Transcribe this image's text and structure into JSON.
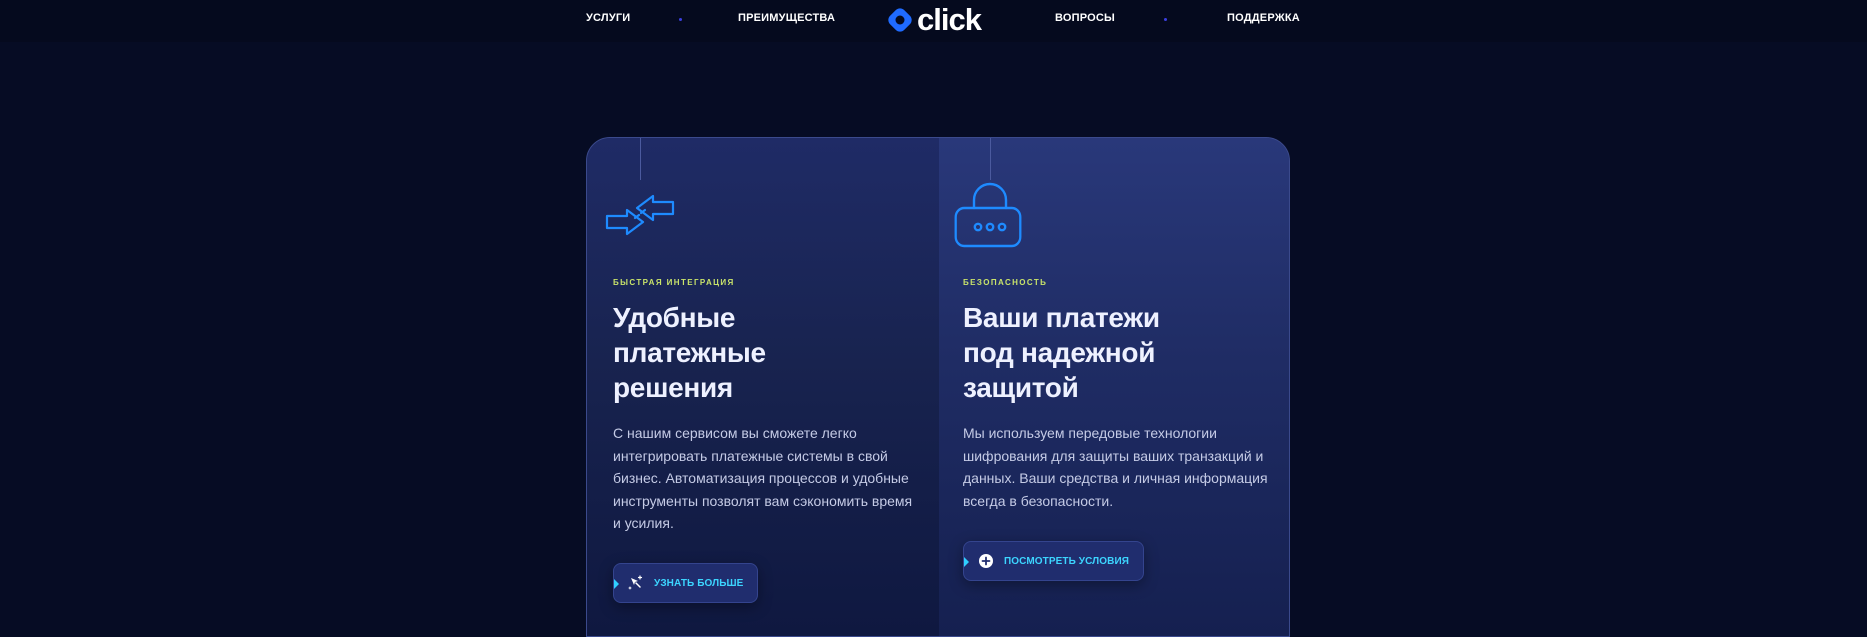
{
  "nav": {
    "left": [
      "УСЛУГИ",
      "ПРЕИМУЩЕСТВА"
    ],
    "right": [
      "ВОПРОСЫ",
      "ПОДДЕРЖКА"
    ],
    "logo_text": "click"
  },
  "cards": [
    {
      "icon": "arrows-exchange-icon",
      "eyebrow": "БЫСТРАЯ ИНТЕГРАЦИЯ",
      "heading": "Удобные платежные решения",
      "body": "С нашим сервисом вы сможете легко интегрировать платежные системы в свой бизнес. Автоматизация процессов и удобные инструменты позволят вам сэкономить время и усилия.",
      "cta_label": "УЗНАТЬ БОЛЬШЕ",
      "cta_icon": "sparkle-cursor-icon"
    },
    {
      "icon": "lock-icon",
      "eyebrow": "БЕЗОПАСНОСТЬ",
      "heading": "Ваши платежи под надежной защитой",
      "body": "Мы используем передовые технологии шифрования для защиты ваших транзакций и данных. Ваши средства и личная информация всегда в безопасности.",
      "cta_label": "ПОСМОТРЕТЬ УСЛОВИЯ",
      "cta_icon": "plus-circle-icon"
    }
  ],
  "colors": {
    "background": "#060c24",
    "accent": "#3cd5ff",
    "eyebrow": "#c9e46a",
    "brand_blue": "#1f6bff"
  }
}
